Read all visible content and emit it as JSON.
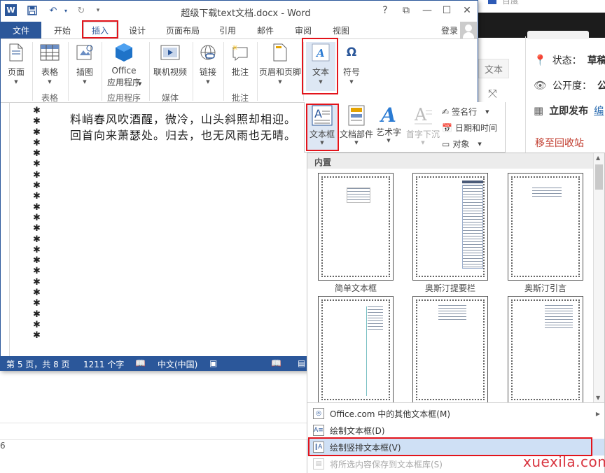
{
  "background_page": {
    "logo_text": "百度",
    "status_label": "状态：",
    "status_value": "草稿",
    "visibility_label": "公开度：",
    "visibility_value": "公",
    "publish_label": "立即发布",
    "publish_link": "编",
    "trash_link": "移至回收站",
    "text_tab": "文本",
    "stray_digit": "6"
  },
  "word": {
    "title": "超级下载text文档.docx - Word",
    "quick_access": {
      "save": "💾",
      "undo": "↶",
      "redo": "↻",
      "customize": "▾"
    },
    "window_controls": {
      "help": "?",
      "restore_ribbon": "⧉",
      "minimize": "—",
      "maximize": "☐",
      "close": "✕"
    },
    "tabs": [
      "文件",
      "开始",
      "插入",
      "设计",
      "页面布局",
      "引用",
      "邮件",
      "审阅",
      "视图"
    ],
    "active_tab": "插入",
    "login": "登录",
    "ribbon": {
      "pages": "页面",
      "table": "表格",
      "illustrations": "插图",
      "office_line1": "Office",
      "office_line2": "应用程序",
      "online_video": "联机视频",
      "link": "链接",
      "comment": "批注",
      "header_footer": "页眉和页脚",
      "text": "文本",
      "symbol": "符号",
      "groups": {
        "table": "表格",
        "apps": "应用程序",
        "media": "媒体",
        "comments": "批注"
      }
    },
    "document": {
      "border_glyph": "✱",
      "paragraph": "料峭春风吹酒醒，微冷，山头斜照却相迎。回首向来萧瑟处。归去，也无风雨也无晴。"
    },
    "status": {
      "page": "第 5 页，共 8 页",
      "words": "1211 个字",
      "language": "中文(中国)"
    }
  },
  "text_gallery": {
    "textbox": "文本框",
    "quick_parts": "文档部件",
    "wordart": "艺术字",
    "dropcap": "首字下沉",
    "signature": "签名行",
    "datetime": "日期和时间",
    "object": "对象"
  },
  "textbox_panel": {
    "header": "内置",
    "items": [
      "简单文本框",
      "奥斯汀提要栏",
      "奥斯汀引言",
      "",
      "",
      ""
    ],
    "menu": {
      "more": "Office.com 中的其他文本框(M)",
      "draw": "绘制文本框(D)",
      "draw_vertical": "绘制竖排文本框(V)",
      "save_selection": "将所选内容保存到文本框库(S)"
    }
  },
  "watermark": "xuexila.com",
  "colors": {
    "word_blue": "#2b579a",
    "highlight_red": "#e3141b",
    "menu_highlight": "#cfe0f5"
  }
}
